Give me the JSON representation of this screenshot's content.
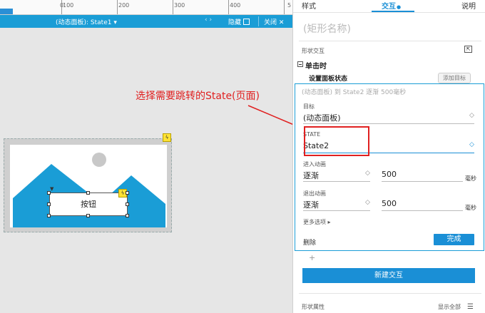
{
  "ruler": {
    "marks": [
      "0",
      "100",
      "200",
      "300",
      "400",
      "5"
    ]
  },
  "topbar": {
    "context": "(动态面板): State1 ▾",
    "nav_arrows": "‹  ›",
    "hide_label": "隐藏",
    "close_label": "关闭"
  },
  "canvas": {
    "button_text": "按钮",
    "annotation": "选择需要跳转的State(页面)",
    "lightning_glyph": "ϟ"
  },
  "panel": {
    "tabs": {
      "style": "样式",
      "interaction": "交互",
      "interaction_dot": "●",
      "notes": "说明"
    },
    "shape_name_placeholder": "(矩形名称)",
    "shape_interaction_label": "形状交互",
    "event_label": "单击时",
    "action_label": "设置面板状态",
    "add_target_label": "添加目标",
    "editor": {
      "summary": "(动态面板) 到 State2 逐渐 500毫秒",
      "target_label": "目标",
      "target_value": "(动态面板)",
      "state_label": "STATE",
      "state_value": "State2",
      "enter_anim_label": "进入动画",
      "enter_anim_value": "逐渐",
      "enter_duration": "500",
      "exit_anim_label": "退出动画",
      "exit_anim_value": "逐渐",
      "exit_duration": "500",
      "unit_ms": "毫秒",
      "more_options": "更多选项 ▸",
      "delete_label": "删除",
      "done_label": "完成"
    },
    "plus": "+",
    "new_interaction_label": "新建交互",
    "shape_props_label": "形状属性",
    "show_all_label": "显示全部"
  },
  "colors": {
    "accent": "#1a8fd6",
    "annotation": "#e02020",
    "mountain": "#1a9dd6"
  }
}
